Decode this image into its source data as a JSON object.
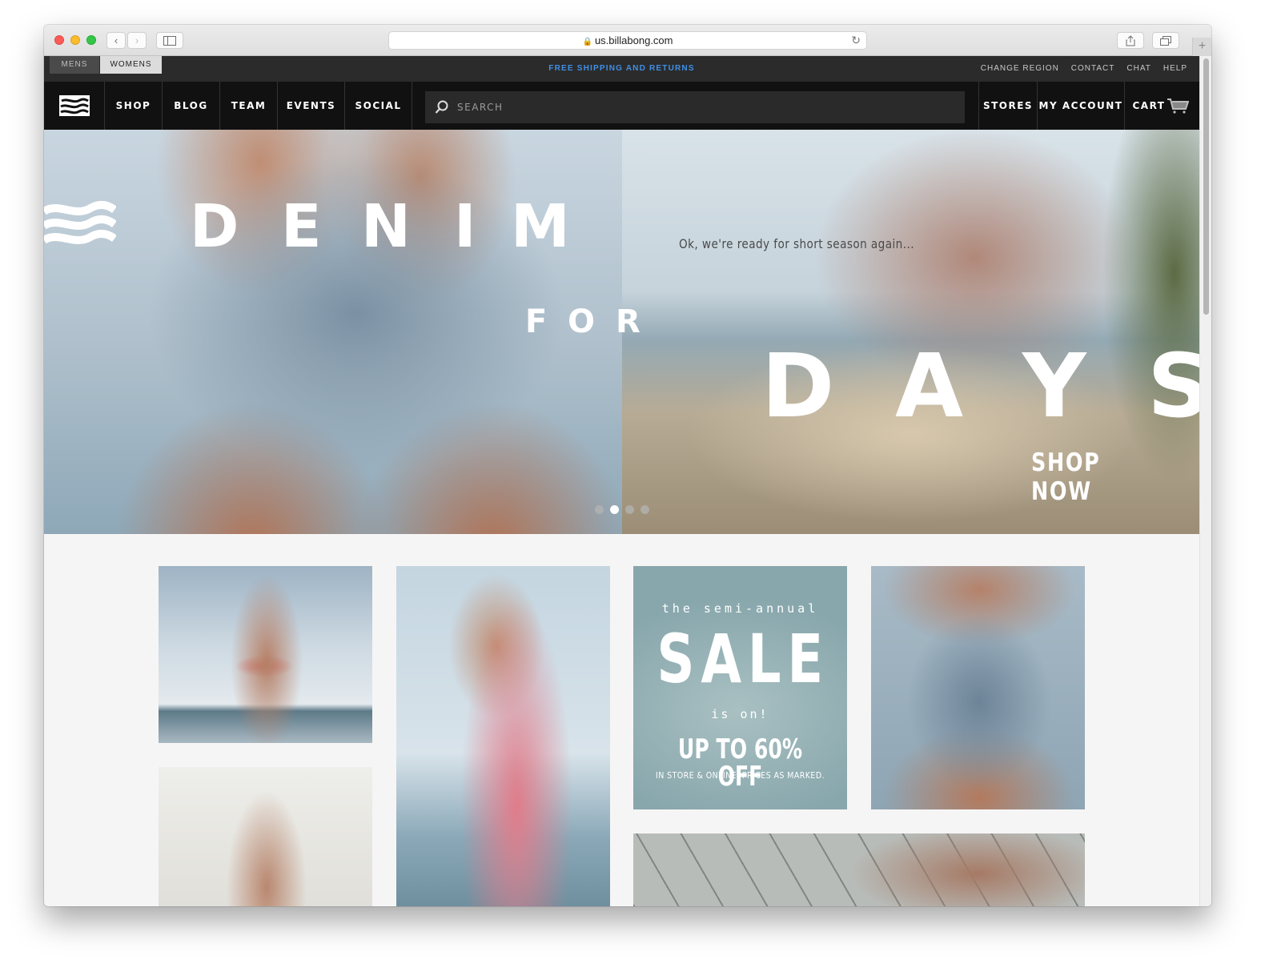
{
  "browser": {
    "url": "us.billabong.com",
    "back_icon": "‹",
    "forward_icon": "›",
    "new_tab_icon": "+"
  },
  "topbar": {
    "gender_tabs": [
      "MENS",
      "WOMENS"
    ],
    "selected_gender": "WOMENS",
    "promo": "FREE SHIPPING AND RETURNS",
    "promo_color": "#3f8fe6",
    "utility_links": [
      "CHANGE REGION",
      "CONTACT",
      "CHAT",
      "HELP"
    ]
  },
  "nav": {
    "items": [
      "SHOP",
      "BLOG",
      "TEAM",
      "EVENTS",
      "SOCIAL"
    ],
    "search_placeholder": "SEARCH",
    "right_items": [
      "STORES",
      "MY ACCOUNT",
      "CART"
    ]
  },
  "hero": {
    "word1": [
      "D",
      "E",
      "N",
      "I",
      "M"
    ],
    "word2": [
      "F",
      "O",
      "R"
    ],
    "word3": [
      "D",
      "A",
      "Y",
      "S"
    ],
    "tagline": "Ok, we're ready for short season again...",
    "cta": "SHOP NOW",
    "slides": 4,
    "active_slide": 2
  },
  "sale_tile": {
    "top": "the semi-annual",
    "big": "SALE",
    "is_on": "is on!",
    "offer": "UP TO 60% OFF",
    "fine_print": "IN STORE & ONLINE. PRICES AS MARKED."
  }
}
